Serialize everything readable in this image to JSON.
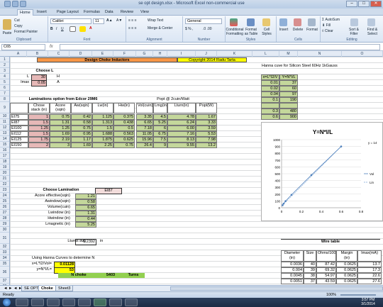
{
  "window": {
    "title": "se opt design.xlsx - Microsoft Excel non-commercial use",
    "minimize": "–",
    "maximize": "□",
    "close": "✕"
  },
  "ribbon_tabs": [
    "Home",
    "Insert",
    "Page Layout",
    "Formulas",
    "Data",
    "Review",
    "View"
  ],
  "ribbon": {
    "clipboard": {
      "paste": "Paste",
      "cut": "Cut",
      "copy": "Copy",
      "format_painter": "Format Painter",
      "label": "Clipboard"
    },
    "font": {
      "name": "Calibri",
      "size": "11",
      "label": "Font"
    },
    "alignment": {
      "wrap": "Wrap Text",
      "merge": "Merge & Center",
      "label": "Alignment"
    },
    "number": {
      "format": "General",
      "label": "Number"
    },
    "styles": {
      "cond": "Conditional Formatting",
      "table": "Format as Table",
      "cell": "Cell Styles",
      "label": "Styles"
    },
    "cells": {
      "insert": "Insert",
      "delete": "Delete",
      "format": "Format",
      "label": "Cells"
    },
    "editing": {
      "autosum": "AutoSum",
      "fill": "Fill",
      "clear": "Clear",
      "sort": "Sort & Filter",
      "find": "Find & Select",
      "label": "Editing"
    }
  },
  "formula_bar": {
    "namebox": "C65",
    "fx": "fx",
    "content": ""
  },
  "columns": [
    "A",
    "B",
    "C",
    "D",
    "E",
    "F",
    "G",
    "H",
    "I",
    "J",
    "K",
    "L",
    "M",
    "N",
    "O"
  ],
  "rows": [
    "1",
    "2",
    "3",
    "4",
    "5",
    "6",
    "7",
    "8",
    "9",
    "10",
    "11",
    "12",
    "13",
    "14",
    "15",
    "16",
    "17",
    "18",
    "19",
    "20",
    "21",
    "22",
    "23",
    "24",
    "25",
    "26",
    "27",
    "28",
    "29",
    "30",
    "31",
    "32",
    "33",
    "34",
    "35",
    "36",
    "37",
    "38",
    "39"
  ],
  "sheet": {
    "title": "Design Choke Inductors",
    "copyright": "Copyright 2014 Radu Tarta",
    "hanna_title": "Hanna cuve for Silicon Steel 60Hz 1kGauss",
    "choose_l": "Choose L",
    "l_label": "L",
    "l_value": "30",
    "l_unit": "H",
    "imax_label": "Imax",
    "imax_value": "0.05",
    "imax_unit": "A",
    "lam_title": "Laminations option from Edcor 29M6",
    "popt_title": "Popt  @ 2cuin/Watt",
    "lam_headers": [
      "",
      "Chose stack (in)",
      "Acore (sqin)",
      "Aw(sqin)",
      "Lw(in)",
      "Hw(in)",
      "Vol(cuin)",
      "Lmg(in)",
      "Lturn(in)",
      "Popt(W)"
    ],
    "lam_rows": [
      [
        "EI75",
        "1",
        "0.75",
        "0.42",
        "1.125",
        "0.375",
        "3.35",
        "4.5",
        "4.78",
        "1.67"
      ],
      [
        "EI87",
        "1.5",
        "1.31",
        "0.58",
        "1.313",
        "0.438",
        "6.65",
        "5.25",
        "6.24",
        "3.33"
      ],
      [
        "EI100",
        "1.25",
        "1.25",
        "0.75",
        "1.5",
        "0.5",
        "7.18",
        "6",
        "6.00",
        "3.59"
      ],
      [
        "EI112",
        "1.5",
        "1.69",
        "0.95",
        "1.688",
        "0.563",
        "11.05",
        "6.75",
        "7.16",
        "5.53"
      ],
      [
        "EI125",
        "1.75",
        "2.19",
        "1.17",
        "1.875",
        "0.625",
        "15.96",
        "7.5",
        "8.13",
        "7.98"
      ],
      [
        "EI150",
        "2",
        "3",
        "1.69",
        "2.25",
        "0.75",
        "26.4",
        "9",
        "9.55",
        "13.2"
      ]
    ],
    "hanna_hdr": [
      "x=L*I2/V",
      "Y=N*I/L"
    ],
    "hanna_rows": [
      [
        "0.01",
        "37"
      ],
      [
        "0.02",
        "60"
      ],
      [
        "0.04",
        "97"
      ],
      [
        "0.1",
        "190"
      ],
      [
        "",
        ""
      ],
      [
        "0.3",
        "480"
      ],
      [
        "0.6",
        "900"
      ]
    ],
    "choose_lam": "Choose Lamination",
    "lam_choice": "EI87",
    "params": [
      [
        "Acore effective(sqin)",
        "1.21"
      ],
      [
        "Awindow(sqin)",
        "0.58"
      ],
      [
        "Volume(cuin)",
        "6.65"
      ],
      [
        "Lwindow (in)",
        "1.31"
      ],
      [
        "Hwindow (in)",
        "0.44"
      ],
      [
        "Lmagnetic (in)",
        "5.25"
      ]
    ],
    "lturns_label": "Lturns avg",
    "lturns_value": "6.2392",
    "lturns_unit": "in",
    "hanna_use": "Using Hanna Curves to determine N",
    "x_label": "x=L*I2/Vol=",
    "x_value": "0.01128",
    "y_label": "y=N*I/L=",
    "y_value": "53",
    "n_label": "N choke",
    "n_value": "5403",
    "turns": "Turns",
    "wire_title": "Wire table",
    "wire_hdr": [
      "Diameter (in)",
      "Size",
      "Ohms/1000ft",
      "Margin (in)",
      "Imax(mA)"
    ],
    "wire_rows": [
      [
        "0.0036",
        "40",
        "87.42",
        "0.0625",
        "13.7"
      ],
      [
        "0.004",
        "39",
        "69.32",
        "0.0625",
        "17.3"
      ],
      [
        "0.0045",
        "38",
        "54.97",
        "0.0625",
        "22.6"
      ],
      [
        "0.0051",
        "37",
        "43.59",
        "0.0625",
        "27.6"
      ]
    ]
  },
  "chart_data": {
    "type": "scatter",
    "title": "Y=N*I/L",
    "x": [
      0.01,
      0.02,
      0.04,
      0.1,
      0.3,
      0.6
    ],
    "y": [
      37,
      60,
      97,
      190,
      480,
      900
    ],
    "xlim": [
      0,
      0.8
    ],
    "ylim": [
      0,
      1000
    ],
    "xticks": [
      "0",
      "0.2",
      "0.4",
      "0.6",
      "0.8"
    ],
    "yticks": [
      "0",
      "100",
      "200",
      "300",
      "400",
      "500",
      "600",
      "700",
      "800",
      "900",
      "1000"
    ],
    "legend": [
      "Vol",
      "Lin"
    ],
    "trend_label": "y = 14"
  },
  "sheet_tabs": [
    "SE OPT",
    "Choke",
    "Sheet3"
  ],
  "status": {
    "ready": "Ready",
    "zoom": "100%"
  },
  "clock": {
    "time": "3:57 PM",
    "date": "3/1/2014"
  }
}
